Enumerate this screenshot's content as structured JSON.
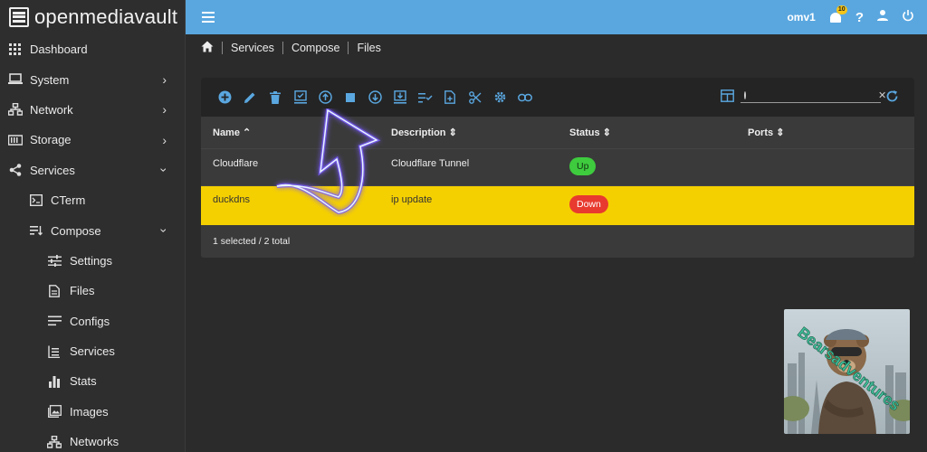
{
  "app": {
    "brand": "openmediavault"
  },
  "topbar": {
    "hostname": "omv1",
    "notification_count": "10"
  },
  "sidebar": {
    "items": [
      {
        "label": "Dashboard",
        "icon": "grid-icon"
      },
      {
        "label": "System",
        "icon": "laptop-icon"
      },
      {
        "label": "Network",
        "icon": "network-icon"
      },
      {
        "label": "Storage",
        "icon": "storage-icon"
      },
      {
        "label": "Services",
        "icon": "share-icon"
      },
      {
        "label": "CTerm",
        "icon": "terminal-icon"
      },
      {
        "label": "Compose",
        "icon": "compose-icon"
      },
      {
        "label": "Settings",
        "icon": "sliders-icon"
      },
      {
        "label": "Files",
        "icon": "file-icon"
      },
      {
        "label": "Configs",
        "icon": "lines-icon"
      },
      {
        "label": "Services",
        "icon": "list-icon"
      },
      {
        "label": "Stats",
        "icon": "bar-chart-icon"
      },
      {
        "label": "Images",
        "icon": "image-icon"
      },
      {
        "label": "Networks",
        "icon": "network-icon"
      }
    ]
  },
  "breadcrumb": {
    "items": [
      "Services",
      "Compose",
      "Files"
    ]
  },
  "table": {
    "columns": [
      "Name",
      "Description",
      "Status",
      "Ports"
    ],
    "rows": [
      {
        "name": "Cloudflare",
        "description": "Cloudflare Tunnel",
        "status": "Up",
        "ports": ""
      },
      {
        "name": "duckdns",
        "description": "ip update",
        "status": "Down",
        "ports": ""
      }
    ],
    "footer": "1 selected / 2 total",
    "selected_row_color": "#f5d000"
  },
  "search": {
    "placeholder": ""
  },
  "watermark": {
    "text": "Bearsadventures"
  },
  "colors": {
    "accent": "#5aa7e0",
    "status_up": "#3ecb3e",
    "status_down": "#e83a2f"
  }
}
